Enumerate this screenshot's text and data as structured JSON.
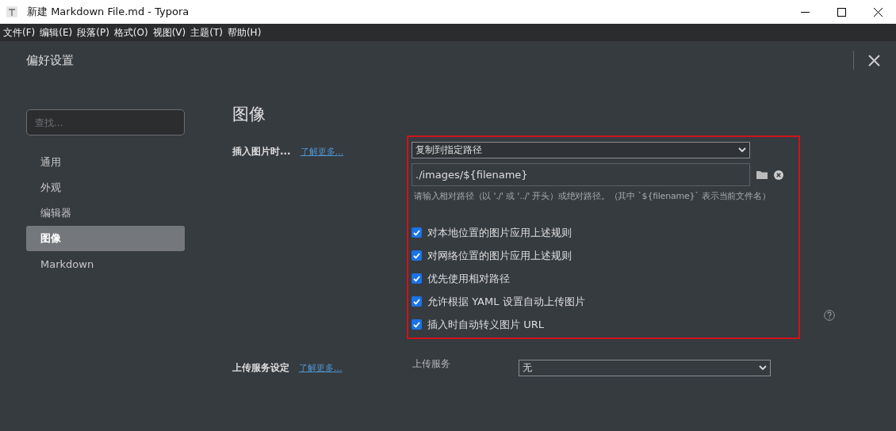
{
  "window": {
    "title": "新建 Markdown File.md - Typora"
  },
  "menu": [
    "文件(F)",
    "编辑(E)",
    "段落(P)",
    "格式(O)",
    "视图(V)",
    "主题(T)",
    "帮助(H)"
  ],
  "dialog": {
    "title": "偏好设置"
  },
  "search": {
    "placeholder": "查找..."
  },
  "sidebar": {
    "items": [
      {
        "label": "通用",
        "selected": false
      },
      {
        "label": "外观",
        "selected": false
      },
      {
        "label": "编辑器",
        "selected": false
      },
      {
        "label": "图像",
        "selected": true
      },
      {
        "label": "Markdown",
        "selected": false
      }
    ]
  },
  "section": {
    "heading": "图像",
    "insert": {
      "label": "插入图片时...",
      "link": "了解更多...",
      "action": "复制到指定路径",
      "path": "./images/${filename}",
      "hint": "请输入相对路径（以 './' 或 '../' 开头）或绝对路径。（其中 `${filename}` 表示当前文件名）",
      "options": [
        {
          "label": "对本地位置的图片应用上述规则",
          "checked": true
        },
        {
          "label": "对网络位置的图片应用上述规则",
          "checked": true
        },
        {
          "label": "优先使用相对路径",
          "checked": true
        },
        {
          "label": "允许根据 YAML 设置自动上传图片",
          "checked": true
        },
        {
          "label": "插入时自动转义图片 URL",
          "checked": true
        }
      ]
    },
    "upload": {
      "label": "上传服务设定",
      "link": "了解更多...",
      "field_label": "上传服务",
      "service": "无"
    }
  }
}
